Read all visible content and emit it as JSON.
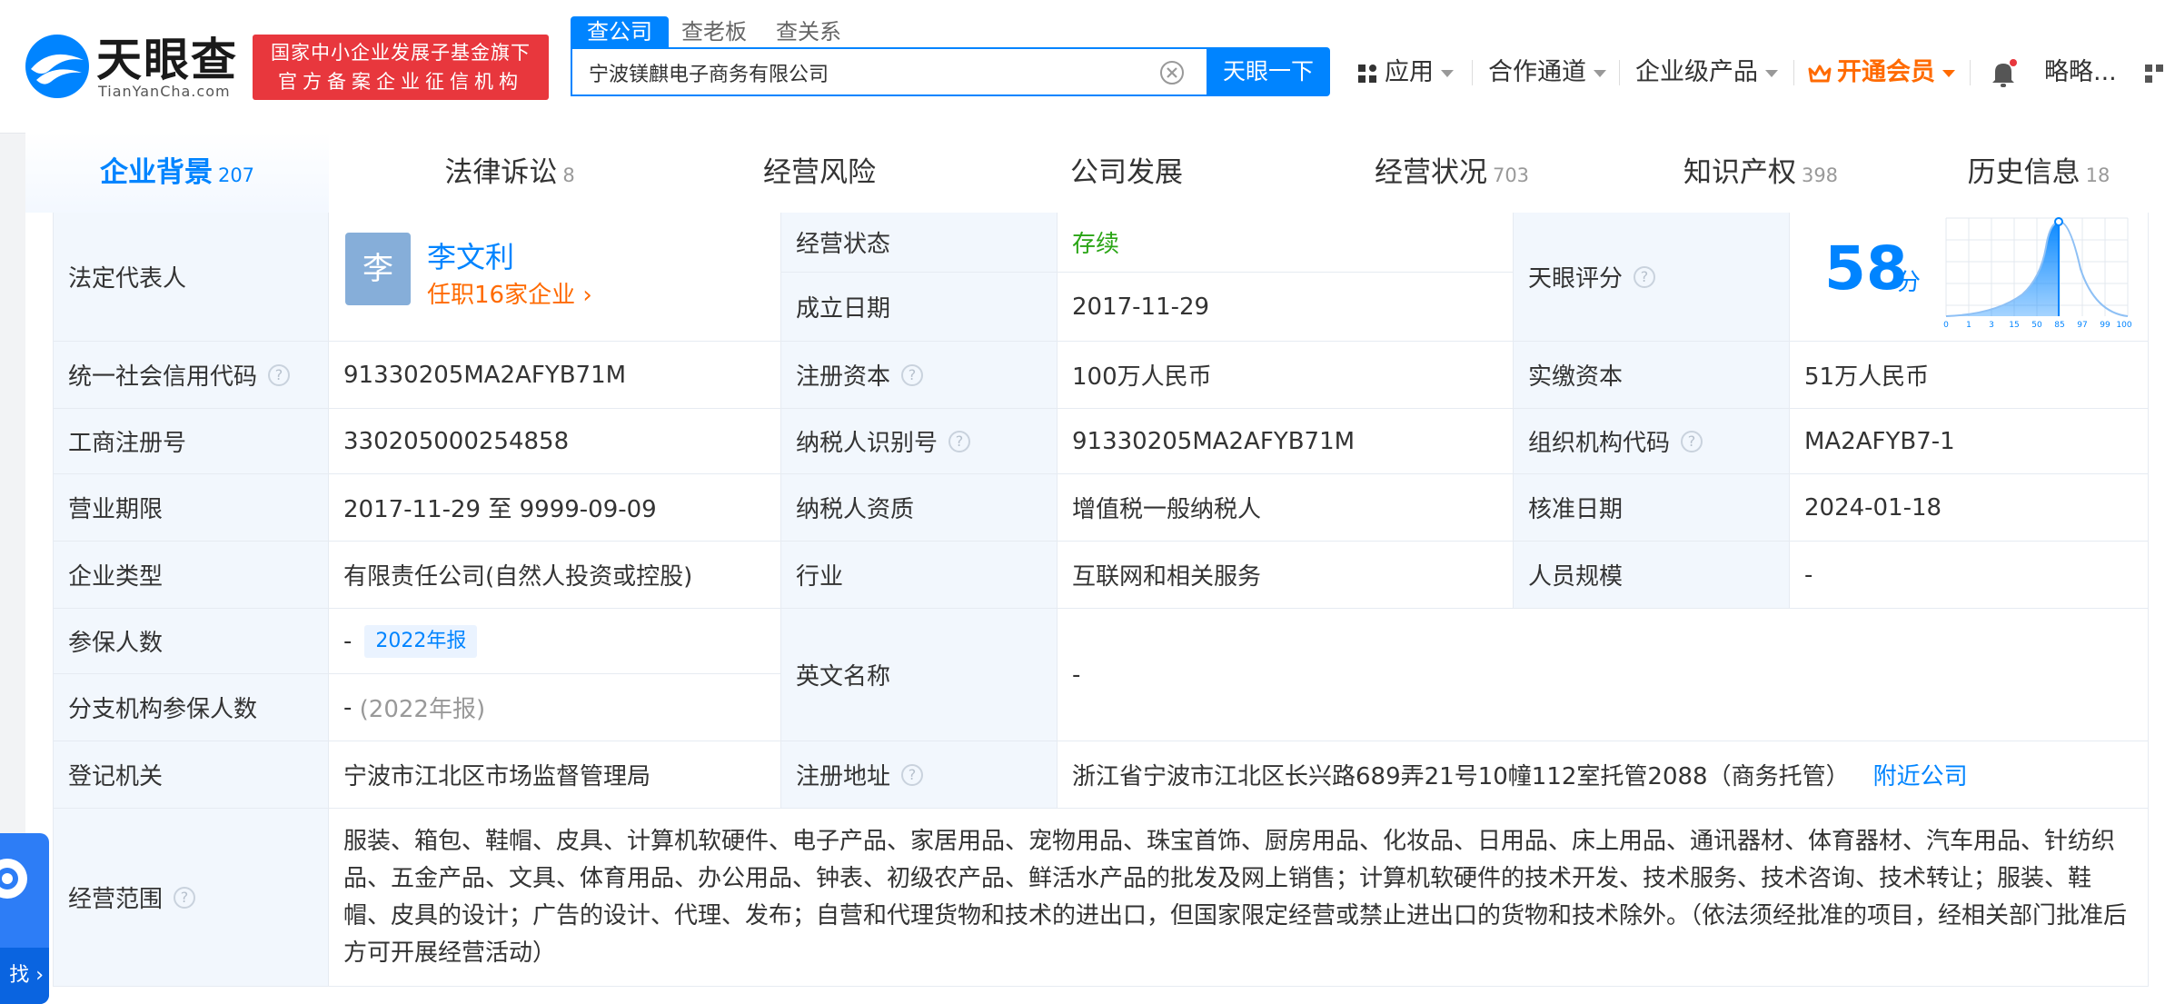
{
  "header": {
    "logo_cn": "天眼查",
    "logo_en": "TianYanCha.com",
    "banner_line1": "国家中小企业发展子基金旗下",
    "banner_line2": "官方备案企业征信机构",
    "search_tabs": [
      "查公司",
      "查老板",
      "查关系"
    ],
    "search_value": "宁波镁麒电子商务有限公司",
    "search_button": "天眼一下",
    "nav": {
      "apps": "应用",
      "partner": "合作通道",
      "enterprise": "企业级产品",
      "vip": "开通会员",
      "user": "略略..."
    }
  },
  "tabs": [
    {
      "label": "企业背景",
      "count": "207"
    },
    {
      "label": "法律诉讼",
      "count": "8"
    },
    {
      "label": "经营风险",
      "count": ""
    },
    {
      "label": "公司发展",
      "count": ""
    },
    {
      "label": "经营状况",
      "count": "703"
    },
    {
      "label": "知识产权",
      "count": "398"
    },
    {
      "label": "历史信息",
      "count": "18"
    }
  ],
  "info": {
    "legal_rep_label": "法定代表人",
    "legal_rep_avatar": "李",
    "legal_rep_name": "李文利",
    "legal_rep_sub": "任职16家企业 ›",
    "status_label": "经营状态",
    "status_value": "存续",
    "founded_label": "成立日期",
    "founded_value": "2017-11-29",
    "score_label": "天眼评分",
    "score_value": "58",
    "score_unit": "分",
    "score_ticks": [
      "0",
      "1",
      "3",
      "15",
      "50",
      "85",
      "97",
      "99",
      "100"
    ],
    "credit_code_label": "统一社会信用代码",
    "credit_code_value": "91330205MA2AFYB71M",
    "reg_capital_label": "注册资本",
    "reg_capital_value": "100万人民币",
    "paid_capital_label": "实缴资本",
    "paid_capital_value": "51万人民币",
    "biz_reg_label": "工商注册号",
    "biz_reg_value": "330205000254858",
    "taxpayer_id_label": "纳税人识别号",
    "taxpayer_id_value": "91330205MA2AFYB71M",
    "org_code_label": "组织机构代码",
    "org_code_value": "MA2AFYB7-1",
    "term_label": "营业期限",
    "term_value": "2017-11-29 至 9999-09-09",
    "taxpayer_qual_label": "纳税人资质",
    "taxpayer_qual_value": "增值税一般纳税人",
    "approval_label": "核准日期",
    "approval_value": "2024-01-18",
    "type_label": "企业类型",
    "type_value": "有限责任公司(自然人投资或控股)",
    "industry_label": "行业",
    "industry_value": "互联网和相关服务",
    "staff_label": "人员规模",
    "staff_value": "-",
    "insured_label": "参保人数",
    "insured_value": "-",
    "insured_tag": "2022年报",
    "english_label": "英文名称",
    "english_value": "-",
    "branch_insured_label": "分支机构参保人数",
    "branch_insured_value": "-",
    "branch_insured_year": "(2022年报)",
    "authority_label": "登记机关",
    "authority_value": "宁波市江北区市场监督管理局",
    "address_label": "注册地址",
    "address_value": "浙江省宁波市江北区长兴路689弄21号10幢112室托管2088（商务托管）",
    "address_link": "附近公司",
    "scope_label": "经营范围",
    "scope_value": "服装、箱包、鞋帽、皮具、计算机软硬件、电子产品、家居用品、宠物用品、珠宝首饰、厨房用品、化妆品、日用品、床上用品、通讯器材、体育器材、汽车用品、针纺织品、五金产品、文具、体育用品、办公用品、钟表、初级农产品、鲜活水产品的批发及网上销售；计算机软硬件的技术开发、技术服务、技术咨询、技术转让；服装、鞋帽、皮具的设计；广告的设计、代理、发布；自营和代理货物和技术的进出口，但国家限定经营或禁止进出口的货物和技术除外。（依法须经批准的项目，经相关部门批准后方可开展经营活动）"
  },
  "float_widget": {
    "label": "找"
  },
  "colors": {
    "brand": "#0084ff",
    "accent_orange": "#ff6a00",
    "status_green": "#2aa515",
    "banner_red": "#e8373d",
    "label_bg": "#f2f7fd"
  }
}
